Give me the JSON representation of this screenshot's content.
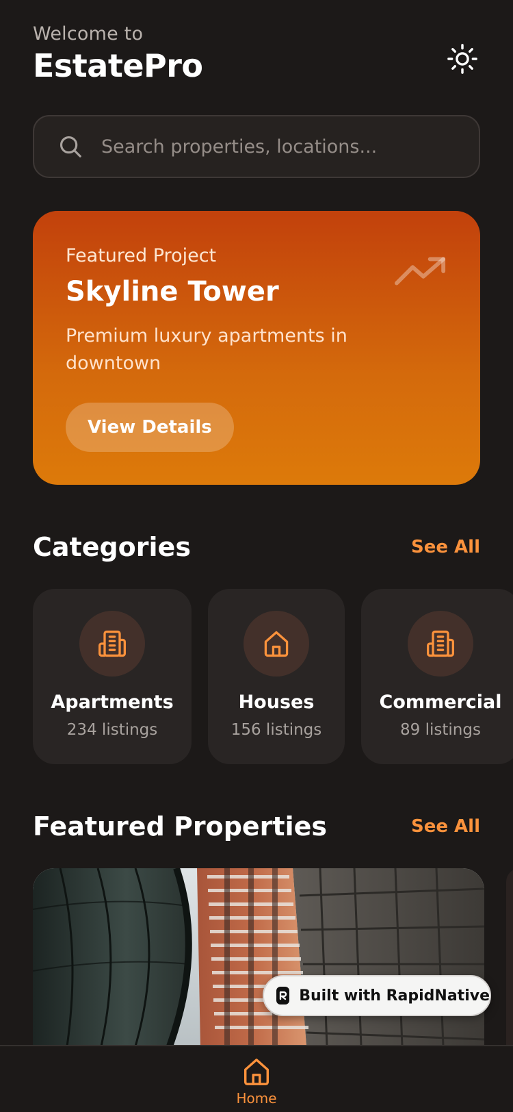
{
  "header": {
    "welcome": "Welcome to",
    "title": "EstatePro",
    "theme_icon": "sun-icon"
  },
  "search": {
    "placeholder": "Search properties, locations...",
    "icon": "search-icon"
  },
  "featured": {
    "eyebrow": "Featured Project",
    "title": "Skyline Tower",
    "description": "Premium luxury apartments in downtown",
    "button_label": "View Details",
    "icon": "trending-up-icon"
  },
  "categories": {
    "title": "Categories",
    "see_all": "See All",
    "items": [
      {
        "name": "Apartments",
        "count": "234 listings",
        "icon": "building-icon"
      },
      {
        "name": "Houses",
        "count": "156 listings",
        "icon": "house-icon"
      },
      {
        "name": "Commercial",
        "count": "89 listings",
        "icon": "building-icon"
      }
    ]
  },
  "featured_properties": {
    "title": "Featured Properties",
    "see_all": "See All"
  },
  "badge": {
    "label": "Built with RapidNative",
    "icon": "rapidnative-logo-icon"
  },
  "nav": {
    "items": [
      {
        "label": "Home",
        "icon": "home-icon",
        "active": true
      }
    ]
  },
  "colors": {
    "background": "#1c1918",
    "accent": "#fb923c",
    "card": "#292524",
    "featured_gradient_top": "#c2410c",
    "featured_gradient_bottom": "#dd7a0a"
  }
}
